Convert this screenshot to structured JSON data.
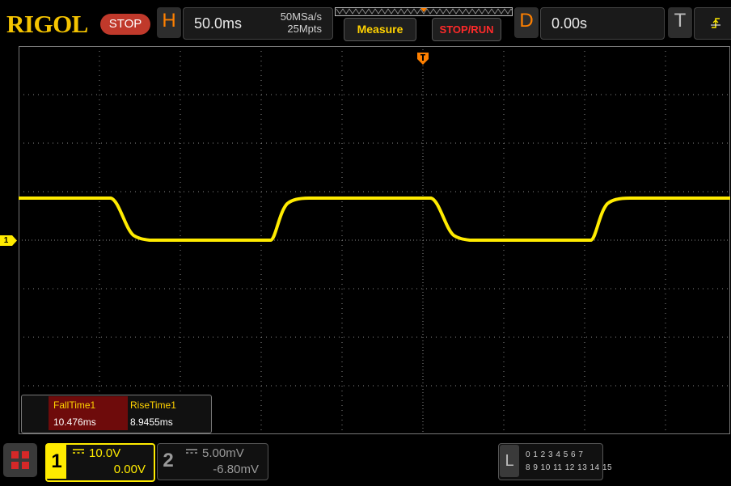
{
  "brand": {
    "logo": "RIGOL",
    "status": "STOP"
  },
  "horizontal": {
    "letter": "H",
    "timebase": "50.0ms",
    "sample_rate": "50MSa/s",
    "memory_depth": "25Mpts"
  },
  "toolbar": {
    "measure_label": "Measure",
    "stoprun_label": "STOP/RUN"
  },
  "delay": {
    "letter": "D",
    "value": "0.00s"
  },
  "trigger": {
    "letter": "T"
  },
  "channel_marker": {
    "label": "1"
  },
  "measurements": [
    {
      "name": "FallTime1",
      "value": "10.476ms"
    },
    {
      "name": "RiseTime1",
      "value": "8.9455ms"
    }
  ],
  "channels": [
    {
      "number": "1",
      "scale": "10.0V",
      "offset": "0.00V",
      "color": "#ffeb00",
      "active": true
    },
    {
      "number": "2",
      "scale": "5.00mV",
      "offset": "-6.80mV",
      "color": "#9a9a9a",
      "active": false
    }
  ],
  "logic_analyzer": {
    "letter": "L",
    "row1": "0 1 2 3  4 5 6 7",
    "row2": "8 9 10 11 12 13 14 15"
  },
  "colors": {
    "trace": "#ffeb00",
    "accent": "#ff8000",
    "grid": "#8a8a8a",
    "stop": "#c0392b"
  }
}
